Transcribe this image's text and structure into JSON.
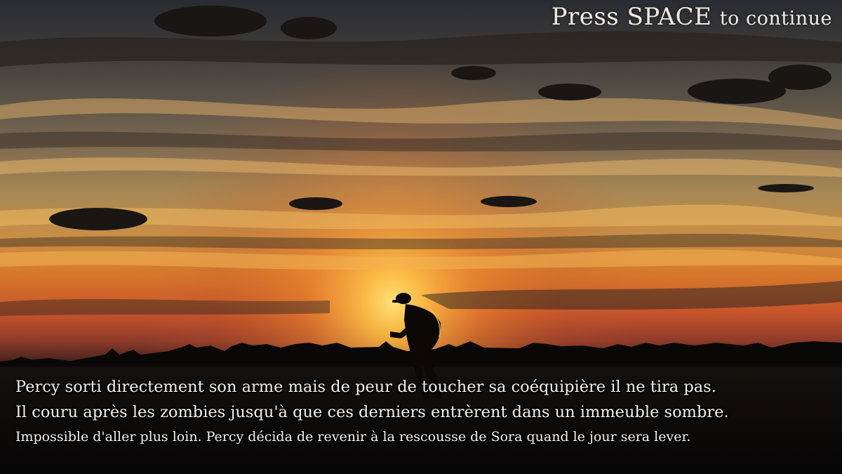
{
  "prompt": {
    "press": "Press SPACE",
    "rest": "to continue"
  },
  "dialogue": {
    "line1": "Percy sorti directement son arme mais de peur de toucher sa coéquipière il ne tira pas.",
    "line2": "Il couru après les zombies jusqu'à que ces derniers entrèrent dans un immeuble sombre.",
    "line3": "Impossible d'aller plus loin. Percy décida de revenir à la rescousse de Sora quand le  jour sera lever."
  },
  "colors": {
    "sun": "#ffd257",
    "sky_top": "#2a2c33",
    "horizon": "#c7542a",
    "ground": "#080707"
  }
}
